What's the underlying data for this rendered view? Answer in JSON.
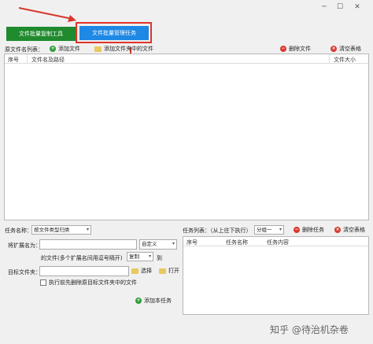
{
  "window": {
    "minimize": "─",
    "maximize": "☐",
    "close": "✕"
  },
  "tabs": {
    "copy_tool": "文件批量复制工具",
    "manage_tasks": "文件批量管理任务"
  },
  "source": {
    "label": "原文件名列表：",
    "add_file": "添加文件",
    "add_folder": "添加文件夹中的文件",
    "delete_file": "删除文件",
    "clear_table": "清空表格",
    "columns": [
      "序号",
      "文件名及路径",
      "文件大小"
    ]
  },
  "task": {
    "name_label": "任务名称：",
    "name_value": "按文件类型归类",
    "ext_label": "将扩展名为：",
    "ext_mode": "自定义",
    "ext_hint": "的文件(多个扩展名间用逗号隔开)",
    "op_mode": "复制",
    "op_suffix": "到",
    "target_label": "目标文件夹：",
    "choose": "选择",
    "open": "打开",
    "delete_before": "执行前先删除原目标文件夹中的文件",
    "add_task": "添加本任务"
  },
  "task_list": {
    "label": "任务列表：（从上往下执行）",
    "group": "分组一",
    "delete_task": "删除任务",
    "clear_table": "清空表格",
    "columns": [
      "序号",
      "任务名称",
      "任务内容"
    ]
  },
  "watermark": "知乎 @待治机杂卷",
  "colors": {
    "green_tab": "#1f8a2e",
    "blue_tab": "#1e88e5",
    "highlight": "#e0342a",
    "arrow": "#d7382d"
  }
}
